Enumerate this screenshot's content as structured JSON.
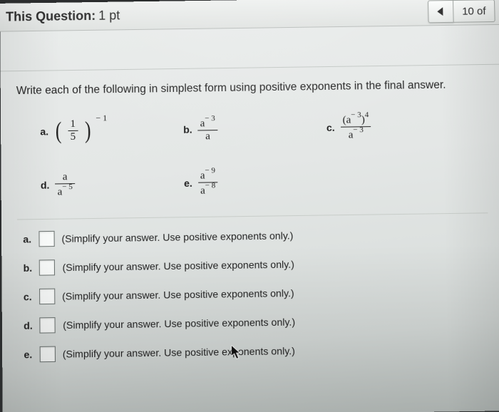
{
  "header": {
    "label_prefix": "This Question:",
    "points": "1 pt",
    "counter": "10 of"
  },
  "prompt": "Write each of the following in simplest form using positive exponents in the final answer.",
  "expressions": {
    "a": {
      "label": "a.",
      "frac_n": "1",
      "frac_d": "5",
      "outer_exp": "− 1"
    },
    "b": {
      "label": "b.",
      "num_base": "a",
      "num_exp": "− 3",
      "den": "a"
    },
    "c": {
      "label": "c.",
      "inner_base": "a",
      "inner_exp": "− 3",
      "outer_exp": "4",
      "den_base": "a",
      "den_exp": "− 3"
    },
    "d": {
      "label": "d.",
      "num": "a",
      "den_base": "a",
      "den_exp": "− 5"
    },
    "e": {
      "label": "e.",
      "num_base": "a",
      "num_exp": "− 9",
      "den_base": "a",
      "den_exp": "− 8"
    }
  },
  "answers": [
    {
      "label": "a.",
      "hint": "(Simplify your answer. Use positive exponents only.)"
    },
    {
      "label": "b.",
      "hint": "(Simplify your answer. Use positive exponents only.)"
    },
    {
      "label": "c.",
      "hint": "(Simplify your answer. Use positive exponents only.)"
    },
    {
      "label": "d.",
      "hint": "(Simplify your answer. Use positive exponents only.)"
    },
    {
      "label": "e.",
      "hint": "(Simplify your answer. Use positive exponents only.)"
    }
  ]
}
